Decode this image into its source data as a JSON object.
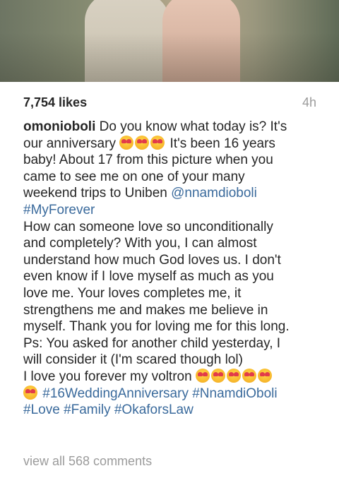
{
  "post": {
    "likes": "7,754 likes",
    "time": "4h",
    "username": "omonioboli",
    "caption": {
      "l1": "Do you know what today is? It's",
      "l2a": "our anniversary",
      "l2b": "It's been 16 years",
      "l3": "baby! About 17 from this picture when you",
      "l4": "came to see me on one of your many",
      "l5a": "weekend trips to Uniben",
      "l5mention": "@nnamdioboli",
      "l6tag": "#MyForever",
      "l7": "How can someone love so unconditionally",
      "l8": "and completely? With you, I can almost",
      "l9": "understand how much God loves us. I don't",
      "l10": "even know if I love myself as much as you",
      "l11": "love me. Your loves completes me, it",
      "l12": "strengthens me and makes me believe in",
      "l13": "myself. Thank you for loving me for this long.",
      "l14": "Ps: You asked for another child yesterday, I",
      "l15": "will consider it (I'm scared though lol)",
      "l16": "I love you forever my voltron",
      "l17tag1": "#16WeddingAnniversary",
      "l17tag2": "#NnamdiOboli",
      "l18tag1": "#Love",
      "l18tag2": "#Family",
      "l18tag3": "#OkaforsLaw"
    },
    "view_comments": "view all 568 comments"
  },
  "icons": {
    "emoji": "heart-eyes-emoji-icon"
  }
}
